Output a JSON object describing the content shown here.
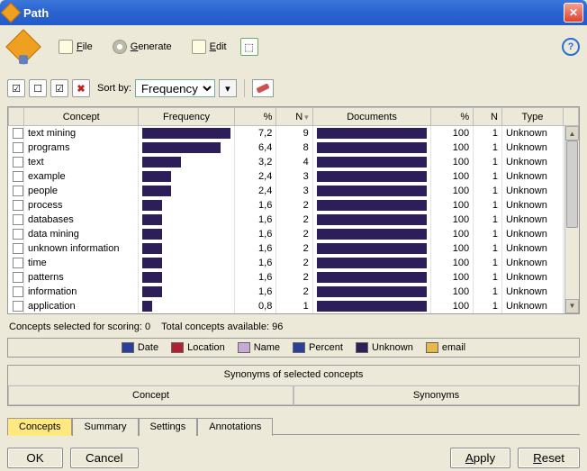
{
  "window": {
    "title": "Path"
  },
  "toolbar": {
    "file": "File",
    "generate": "Generate",
    "edit": "Edit"
  },
  "sortbar": {
    "label": "Sort by:",
    "value": "Frequency"
  },
  "columns": {
    "concept": "Concept",
    "frequency": "Frequency",
    "pct": "%",
    "n1": "N",
    "documents": "Documents",
    "pct2": "%",
    "n2": "N",
    "type": "Type"
  },
  "rows": [
    {
      "concept": "text mining",
      "freqBar": 100,
      "pct": "7,2",
      "n1": "9",
      "docBar": 100,
      "pct2": "100",
      "n2": "1",
      "type": "Unknown"
    },
    {
      "concept": "programs",
      "freqBar": 89,
      "pct": "6,4",
      "n1": "8",
      "docBar": 100,
      "pct2": "100",
      "n2": "1",
      "type": "Unknown"
    },
    {
      "concept": "text",
      "freqBar": 44,
      "pct": "3,2",
      "n1": "4",
      "docBar": 100,
      "pct2": "100",
      "n2": "1",
      "type": "Unknown"
    },
    {
      "concept": "example",
      "freqBar": 33,
      "pct": "2,4",
      "n1": "3",
      "docBar": 100,
      "pct2": "100",
      "n2": "1",
      "type": "Unknown"
    },
    {
      "concept": "people",
      "freqBar": 33,
      "pct": "2,4",
      "n1": "3",
      "docBar": 100,
      "pct2": "100",
      "n2": "1",
      "type": "Unknown"
    },
    {
      "concept": "process",
      "freqBar": 22,
      "pct": "1,6",
      "n1": "2",
      "docBar": 100,
      "pct2": "100",
      "n2": "1",
      "type": "Unknown"
    },
    {
      "concept": "databases",
      "freqBar": 22,
      "pct": "1,6",
      "n1": "2",
      "docBar": 100,
      "pct2": "100",
      "n2": "1",
      "type": "Unknown"
    },
    {
      "concept": "data mining",
      "freqBar": 22,
      "pct": "1,6",
      "n1": "2",
      "docBar": 100,
      "pct2": "100",
      "n2": "1",
      "type": "Unknown"
    },
    {
      "concept": "unknown information",
      "freqBar": 22,
      "pct": "1,6",
      "n1": "2",
      "docBar": 100,
      "pct2": "100",
      "n2": "1",
      "type": "Unknown"
    },
    {
      "concept": "time",
      "freqBar": 22,
      "pct": "1,6",
      "n1": "2",
      "docBar": 100,
      "pct2": "100",
      "n2": "1",
      "type": "Unknown"
    },
    {
      "concept": "patterns",
      "freqBar": 22,
      "pct": "1,6",
      "n1": "2",
      "docBar": 100,
      "pct2": "100",
      "n2": "1",
      "type": "Unknown"
    },
    {
      "concept": "information",
      "freqBar": 22,
      "pct": "1,6",
      "n1": "2",
      "docBar": 100,
      "pct2": "100",
      "n2": "1",
      "type": "Unknown"
    },
    {
      "concept": "application",
      "freqBar": 11,
      "pct": "0,8",
      "n1": "1",
      "docBar": 100,
      "pct2": "100",
      "n2": "1",
      "type": "Unknown"
    }
  ],
  "status": {
    "selected_label": "Concepts selected for scoring:",
    "selected_count": "0",
    "available_label": "Total concepts available:",
    "available_count": "96"
  },
  "legend": [
    {
      "label": "Date",
      "color": "#2a3f9a"
    },
    {
      "label": "Location",
      "color": "#b02030"
    },
    {
      "label": "Name",
      "color": "#c8a8d8"
    },
    {
      "label": "Percent",
      "color": "#2a3f9a"
    },
    {
      "label": "Unknown",
      "color": "#2d1e5a"
    },
    {
      "label": "email",
      "color": "#e8b84a"
    }
  ],
  "synonyms": {
    "title": "Synonyms of selected concepts",
    "col1": "Concept",
    "col2": "Synonyms"
  },
  "tabs": [
    "Concepts",
    "Summary",
    "Settings",
    "Annotations"
  ],
  "active_tab": 0,
  "buttons": {
    "ok": "OK",
    "cancel": "Cancel",
    "apply": "Apply",
    "reset": "Reset"
  },
  "chart_data": {
    "type": "table",
    "title": "Concept frequency table",
    "columns": [
      "Concept",
      "Frequency %",
      "N (freq)",
      "Documents %",
      "N (docs)",
      "Type"
    ],
    "series": [
      {
        "name": "text mining",
        "values": [
          7.2,
          9,
          100,
          1,
          "Unknown"
        ]
      },
      {
        "name": "programs",
        "values": [
          6.4,
          8,
          100,
          1,
          "Unknown"
        ]
      },
      {
        "name": "text",
        "values": [
          3.2,
          4,
          100,
          1,
          "Unknown"
        ]
      },
      {
        "name": "example",
        "values": [
          2.4,
          3,
          100,
          1,
          "Unknown"
        ]
      },
      {
        "name": "people",
        "values": [
          2.4,
          3,
          100,
          1,
          "Unknown"
        ]
      },
      {
        "name": "process",
        "values": [
          1.6,
          2,
          100,
          1,
          "Unknown"
        ]
      },
      {
        "name": "databases",
        "values": [
          1.6,
          2,
          100,
          1,
          "Unknown"
        ]
      },
      {
        "name": "data mining",
        "values": [
          1.6,
          2,
          100,
          1,
          "Unknown"
        ]
      },
      {
        "name": "unknown information",
        "values": [
          1.6,
          2,
          100,
          1,
          "Unknown"
        ]
      },
      {
        "name": "time",
        "values": [
          1.6,
          2,
          100,
          1,
          "Unknown"
        ]
      },
      {
        "name": "patterns",
        "values": [
          1.6,
          2,
          100,
          1,
          "Unknown"
        ]
      },
      {
        "name": "information",
        "values": [
          1.6,
          2,
          100,
          1,
          "Unknown"
        ]
      },
      {
        "name": "application",
        "values": [
          0.8,
          1,
          100,
          1,
          "Unknown"
        ]
      }
    ]
  }
}
